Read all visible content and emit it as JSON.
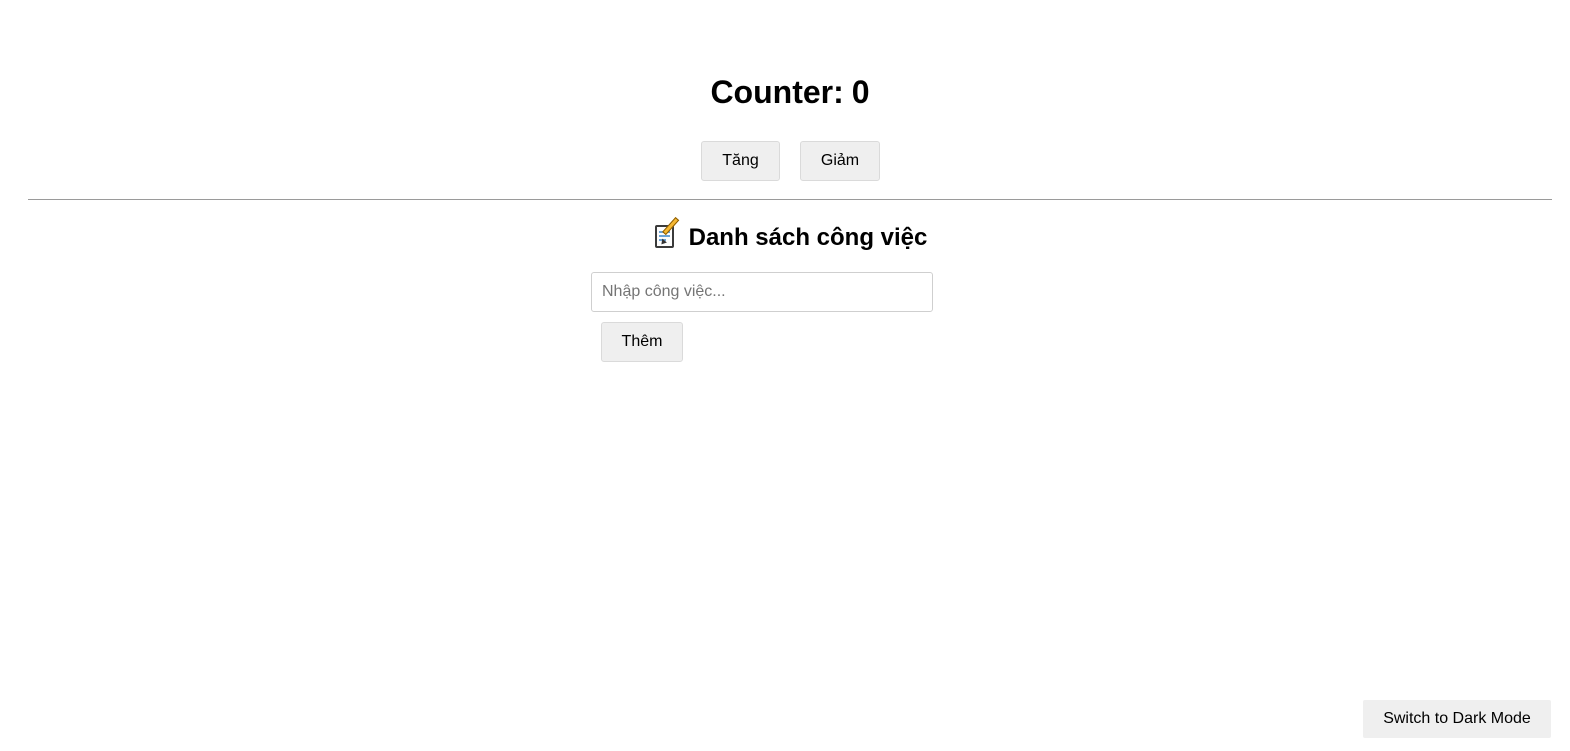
{
  "counter": {
    "label": "Counter:",
    "value": "0",
    "increase_label": "Tăng",
    "decrease_label": "Giảm"
  },
  "todo": {
    "icon": "memo-icon",
    "title": "Danh sách công việc",
    "input_value": "",
    "input_placeholder": "Nhập công việc...",
    "add_label": "Thêm",
    "items": []
  },
  "theme": {
    "toggle_label": "Switch to Dark Mode"
  },
  "colors": {
    "background": "#ffffff",
    "button_bg": "#efefef",
    "divider": "#9a9a9a"
  }
}
